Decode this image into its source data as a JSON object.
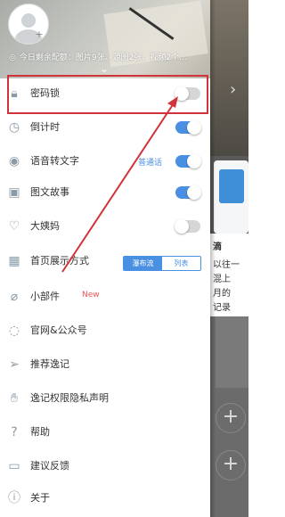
{
  "header": {
    "quota_text": "今日剩余配额：图片9张、源图2张、视频2个..."
  },
  "menu": [
    {
      "label": "密码锁",
      "icon": "lock-icon",
      "control": "toggle",
      "on": false
    },
    {
      "label": "倒计时",
      "icon": "clock-icon",
      "control": "toggle",
      "on": true
    },
    {
      "label": "语音转文字",
      "icon": "voice-icon",
      "control": "toggle",
      "on": true,
      "mode": "普通话"
    },
    {
      "label": "图文故事",
      "icon": "image-icon",
      "control": "toggle",
      "on": true
    },
    {
      "label": "大姨妈",
      "icon": "heart-icon",
      "control": "toggle",
      "on": false
    },
    {
      "label": "首页展示方式",
      "icon": "grid-icon",
      "control": "segmented",
      "options": [
        "瀑布流",
        "列表"
      ],
      "selected": "瀑布流"
    },
    {
      "label": "小部件",
      "icon": "widget-icon",
      "tag": "New"
    },
    {
      "label": "官网&公众号",
      "icon": "wechat-icon"
    },
    {
      "label": "推荐逸记",
      "icon": "send-icon"
    },
    {
      "label": "逸记权限隐私声明",
      "icon": "hand-icon"
    },
    {
      "label": "帮助",
      "icon": "help-icon"
    },
    {
      "label": "建议反馈",
      "icon": "feedback-icon"
    },
    {
      "label": "关于",
      "icon": "info-icon"
    }
  ],
  "background": {
    "card_text": [
      "滴",
      "以往一",
      "混上",
      "月的",
      "记录"
    ],
    "fab_symbol": "+"
  },
  "colors": {
    "accent": "#4a90e2",
    "highlight": "#d0343a"
  }
}
